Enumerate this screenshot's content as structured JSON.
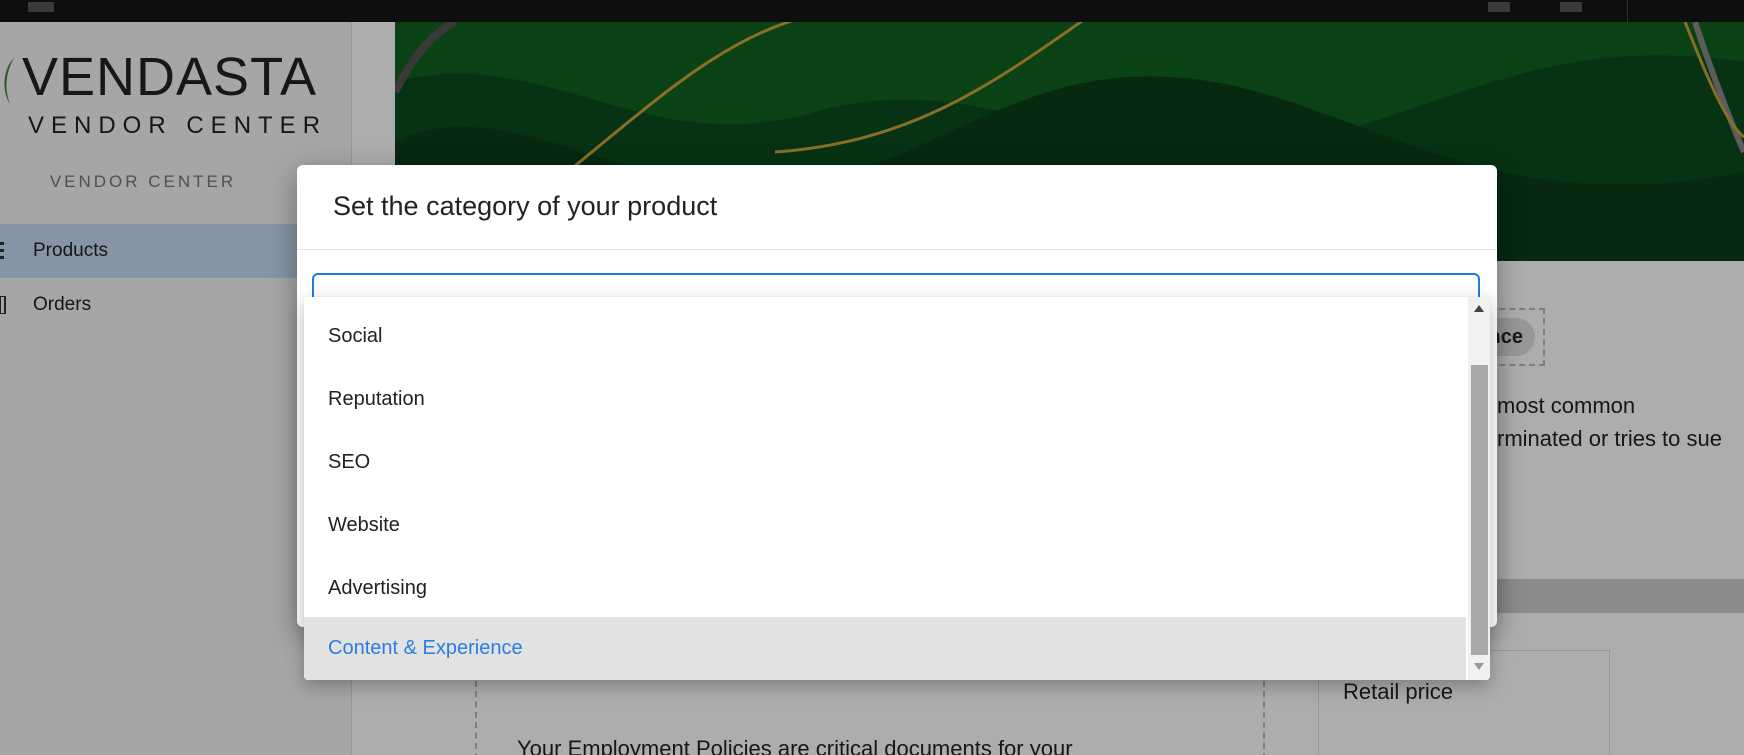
{
  "sidebar": {
    "logo_main": "VENDASTA",
    "logo_sub": "VENDOR CENTER",
    "section_label": "VENDOR CENTER",
    "items": [
      {
        "label": "Products",
        "active": true,
        "icon": "list-icon"
      },
      {
        "label": "Orders",
        "active": false,
        "icon": "receipt-icon"
      }
    ]
  },
  "main": {
    "chip_text": "nce",
    "text_line1": "most common",
    "text_line2": "rminated or tries to sue",
    "price_label": "Retail price",
    "description": "Your Employment Policies are critical documents for your"
  },
  "dialog": {
    "title": "Set the category of your product",
    "select_value": ""
  },
  "dropdown": {
    "options": [
      "Social",
      "Reputation",
      "SEO",
      "Website",
      "Advertising",
      "Content & Experience"
    ],
    "selected_index": 5
  },
  "colors": {
    "accent": "#1e7be0",
    "selected_text": "#2a7de1",
    "nav_active": "#c4dcf4",
    "topbar": "#161616"
  }
}
